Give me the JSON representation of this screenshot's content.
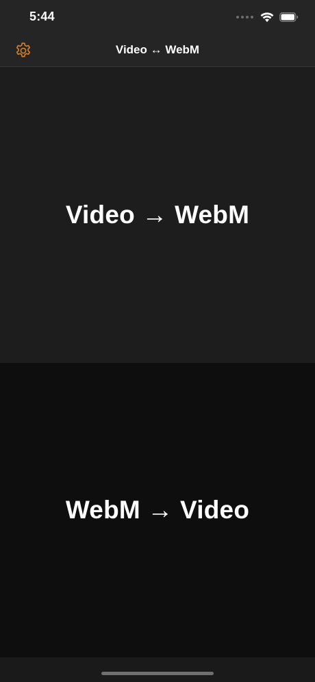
{
  "status_bar": {
    "time": "5:44",
    "icons": [
      "signal-dots-icon",
      "wifi-icon",
      "battery-icon"
    ]
  },
  "nav": {
    "title": "Video ↔ WebM",
    "settings_icon": "gear-icon",
    "accent_color": "#d9822b"
  },
  "panels": [
    {
      "label": "Video → WebM",
      "background": "#1d1d1d"
    },
    {
      "label": "WebM → Video",
      "background": "#0e0e0e"
    }
  ]
}
